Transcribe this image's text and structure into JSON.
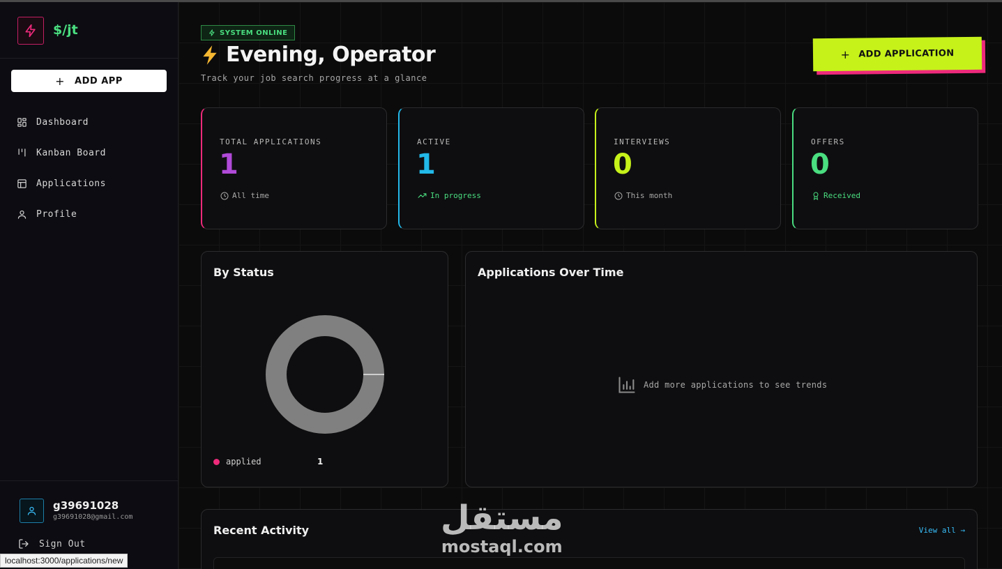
{
  "brand": {
    "logo_text": "$/jt"
  },
  "sidebar": {
    "add_button": "ADD APP",
    "nav": [
      {
        "label": "Dashboard",
        "icon": "grid-icon"
      },
      {
        "label": "Kanban Board",
        "icon": "kanban-icon"
      },
      {
        "label": "Applications",
        "icon": "table-icon"
      },
      {
        "label": "Profile",
        "icon": "user-icon"
      }
    ],
    "user": {
      "name": "g39691028",
      "email": "g39691028@gmail.com"
    },
    "sign_out": "Sign Out"
  },
  "header": {
    "status_badge": "SYSTEM ONLINE",
    "greeting": "Evening, Operator",
    "subtitle": "Track your job search progress at a glance",
    "add_button": "ADD APPLICATION"
  },
  "stats": [
    {
      "label": "TOTAL APPLICATIONS",
      "value": "1",
      "foot": "All time",
      "accent": "#ee2a7b",
      "value_color": "#b04ad8",
      "foot_color": "#a8a8a8",
      "foot_icon": "clock-icon"
    },
    {
      "label": "ACTIVE",
      "value": "1",
      "foot": "In progress",
      "accent": "#22b8e8",
      "value_color": "#22b8e8",
      "foot_color": "#4ade80",
      "foot_icon": "trending-up-icon"
    },
    {
      "label": "INTERVIEWS",
      "value": "0",
      "foot": "This month",
      "accent": "#c6f21a",
      "value_color": "#c6f21a",
      "foot_color": "#a8a8a8",
      "foot_icon": "clock-icon"
    },
    {
      "label": "OFFERS",
      "value": "0",
      "foot": "Received",
      "accent": "#4ade80",
      "value_color": "#4ade80",
      "foot_color": "#4ade80",
      "foot_icon": "award-icon"
    }
  ],
  "by_status": {
    "title": "By Status",
    "legend": [
      {
        "label": "applied",
        "count": "1",
        "color": "#ee2a7b"
      }
    ]
  },
  "chart_data": {
    "type": "pie",
    "categories": [
      "applied"
    ],
    "values": [
      1
    ],
    "title": "By Status",
    "legend_placement": "bottom-left"
  },
  "over_time": {
    "title": "Applications Over Time",
    "empty_message": "Add more applications to see trends"
  },
  "recent_activity": {
    "title": "Recent Activity",
    "view_all": "View all →"
  },
  "watermark": {
    "arabic": "مستقل",
    "latin": "mostaql.com"
  },
  "status_url": "localhost:3000/applications/new"
}
